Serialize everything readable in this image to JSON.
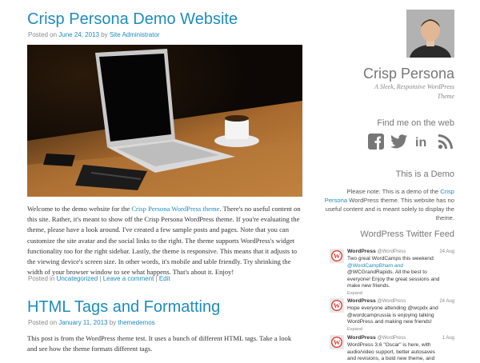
{
  "post1": {
    "title": "Crisp Persona Demo Website",
    "meta_prefix": "Posted on ",
    "date": "June 24, 2013",
    "meta_by": " by ",
    "author": "Site Administrator",
    "body_1": "Welcome to the demo website for the ",
    "body_link": "Crisp Persona WordPress theme",
    "body_2": ". There's no useful content on this site. Rather, it's meant to show off the Crisp Persona WordPress theme. If you're evaluating the theme, please have a look around. I've created a few sample posts and pages. Note that you can customize the site avatar and the social links to the right. The theme supports WordPress's widget functionality too for the right sidebar. Lastly, the theme is responsive. This means that it adjusts to the viewing device's screen size. In other words, it's mobile and table friendly. Try shrinking the width of your browser window to see what happens. That's about it. Enjoy!",
    "footer_prefix": "Posted in ",
    "category": "Uncategorized",
    "sep1": " | ",
    "comment_link": "Leave a comment",
    "sep2": " | ",
    "edit_link": "Edit"
  },
  "post2": {
    "title": "HTML Tags and Formatting",
    "meta_prefix": "Posted on ",
    "date": "January 11, 2013",
    "meta_by": " by ",
    "author": "themedemos",
    "body": "This post is from the WordPress theme test. It uses a bunch of different HTML tags. Take a look and see how the theme formats different tags."
  },
  "sidebar": {
    "site_title": "Crisp Persona",
    "tagline": "A Sleek, Responsive WordPress Theme",
    "social_title": "Find me on the web",
    "social_icons": [
      "facebook-icon",
      "twitter-icon",
      "linkedin-icon",
      "rss-icon"
    ],
    "demo_title": "This is a Demo",
    "demo_text_1": "Please note: This is a demo of the ",
    "demo_link": "Crisp Persona",
    "demo_text_2": " WordPress theme. This website has no useful content and is meant solely to display the theme.",
    "twitter_title": "WordPress Twitter Feed"
  },
  "tweets": [
    {
      "name": "WordPress",
      "handle": "@WordPress",
      "date": "24 Aug",
      "lines": [
        "Two great WordCamps this weekend:",
        "@WordCampBham and",
        "@WCGrandRapids. All the best to",
        "everyone! Enjoy the great sessions and",
        "make new friends."
      ],
      "expand": "Expand"
    },
    {
      "name": "WordPress",
      "handle": "@WordPress",
      "date": "24 Aug",
      "lines": [
        "Hope everyone attending @wcpdx and",
        "@wordcamprussia is enjoying talking",
        "WordPress and making new friends!"
      ],
      "expand": "Expand"
    },
    {
      "name": "WordPress",
      "handle": "@WordPress",
      "date": "1 Aug",
      "lines": [
        "WordPress 3.6 \"Oscar\" is here, with",
        "audio/video support, better autosaves",
        "and revisions, a bold new theme, and"
      ],
      "expand": ""
    }
  ],
  "colors": {
    "link": "#1e8cbe",
    "text": "#444444",
    "muted": "#888888"
  }
}
